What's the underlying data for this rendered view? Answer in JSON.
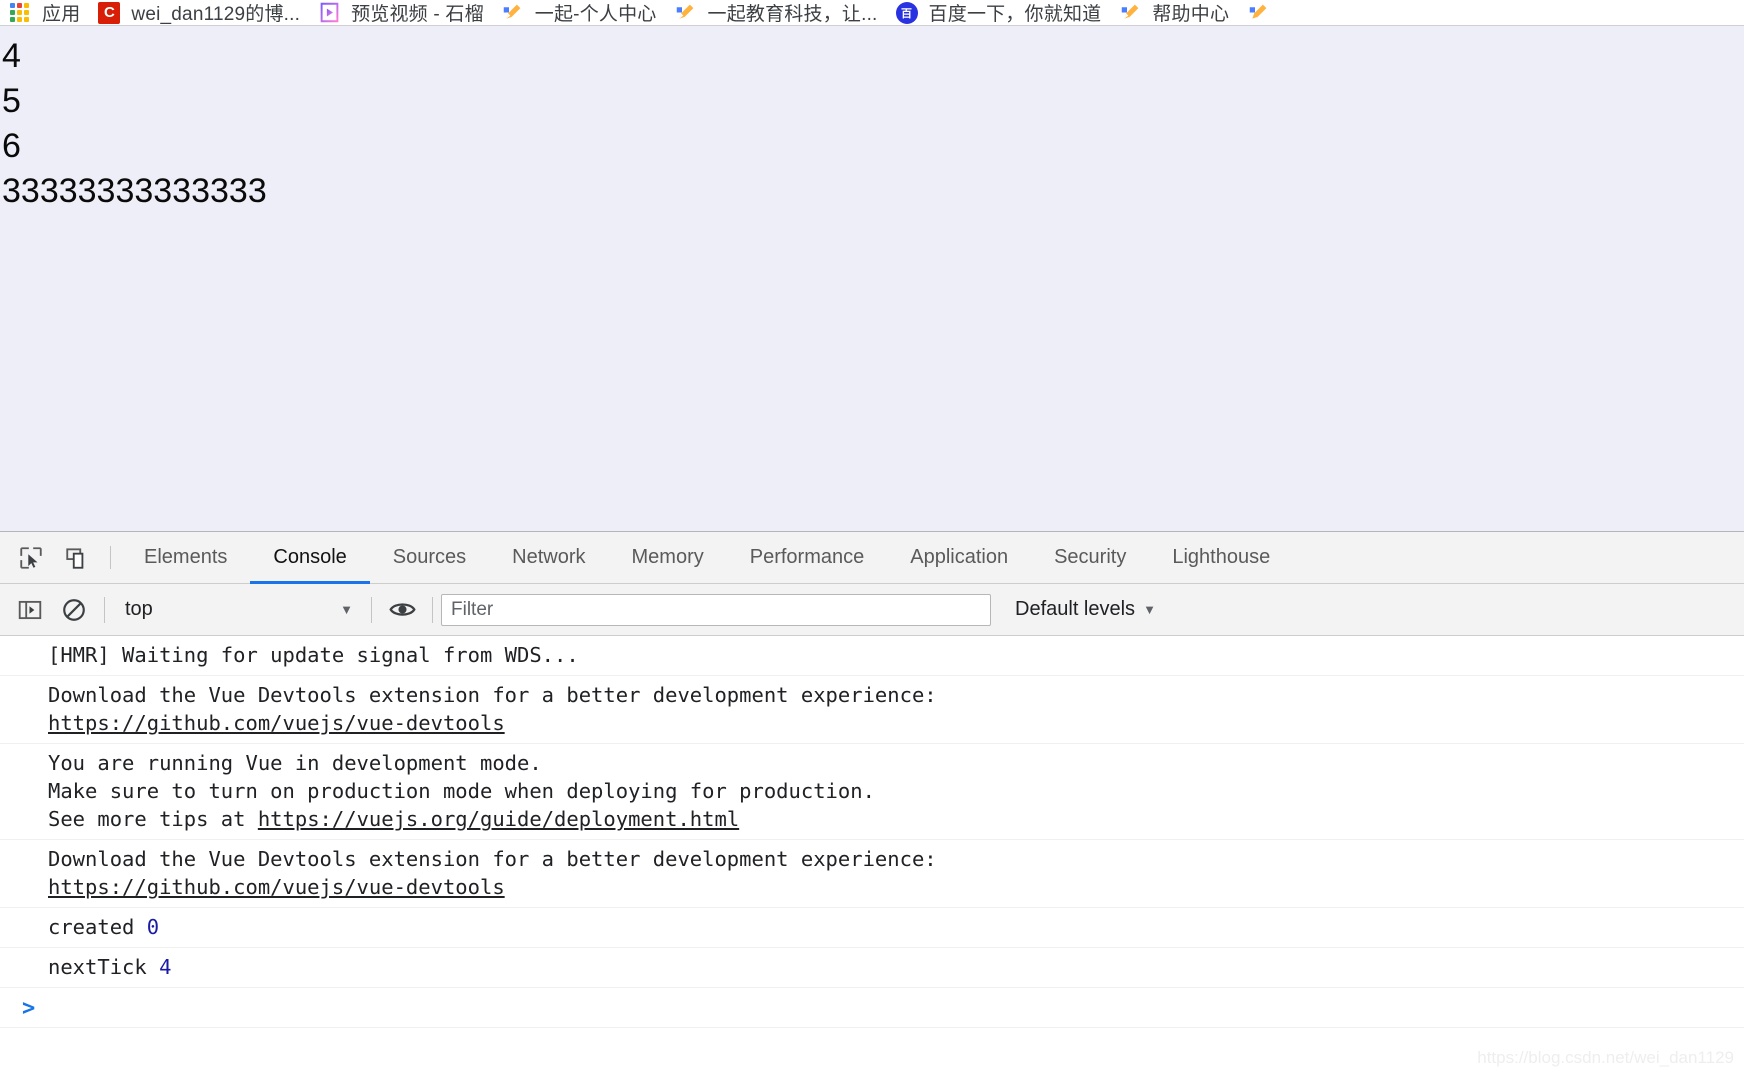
{
  "bookmarks": {
    "items": [
      {
        "label": "应用",
        "icon": "apps-grid-icon"
      },
      {
        "label": "wei_dan1129的博...",
        "icon": "csdn-icon"
      },
      {
        "label": "预览视频 - 石榴",
        "icon": "video-play-icon"
      },
      {
        "label": "一起-个人中心",
        "icon": "pencil-icon"
      },
      {
        "label": "一起教育科技，让...",
        "icon": "pencil-icon"
      },
      {
        "label": "百度一下，你就知道",
        "icon": "baidu-icon"
      },
      {
        "label": "帮助中心",
        "icon": "pencil-icon"
      }
    ],
    "csdn_glyph": "C",
    "baidu_glyph": "百"
  },
  "page": {
    "background_color": "#eeeef8",
    "lines": [
      "4",
      "5",
      "6",
      "33333333333333"
    ]
  },
  "devtools": {
    "toolbar_icons": {
      "inspect": "inspect-element-icon",
      "device": "device-toolbar-icon"
    },
    "tabs": [
      {
        "label": "Elements",
        "active": false
      },
      {
        "label": "Console",
        "active": true
      },
      {
        "label": "Sources",
        "active": false
      },
      {
        "label": "Network",
        "active": false
      },
      {
        "label": "Memory",
        "active": false
      },
      {
        "label": "Performance",
        "active": false
      },
      {
        "label": "Application",
        "active": false
      },
      {
        "label": "Security",
        "active": false
      },
      {
        "label": "Lighthouse",
        "active": false
      }
    ],
    "active_tab_color": "#1a73e8",
    "filterbar": {
      "sidebar_icon": "console-sidebar-icon",
      "clear_icon": "clear-console-icon",
      "context": "top",
      "context_caret": "▼",
      "eye_icon": "live-expression-eye-icon",
      "filter_placeholder": "Filter",
      "filter_value": "",
      "levels": "Default levels",
      "levels_caret": "▼"
    },
    "console": {
      "messages": [
        {
          "id": "hmr",
          "parts": [
            {
              "t": "[HMR] Waiting for update signal from WDS...",
              "k": "text"
            }
          ]
        },
        {
          "id": "vue-devtools-1",
          "parts": [
            {
              "t": "Download the Vue Devtools extension for a better development experience:\n",
              "k": "text"
            },
            {
              "t": "https://github.com/vuejs/vue-devtools",
              "k": "link"
            }
          ]
        },
        {
          "id": "vue-dev-mode",
          "parts": [
            {
              "t": "You are running Vue in development mode.\nMake sure to turn on production mode when deploying for production.\nSee more tips at ",
              "k": "text"
            },
            {
              "t": "https://vuejs.org/guide/deployment.html",
              "k": "link"
            }
          ]
        },
        {
          "id": "vue-devtools-2",
          "parts": [
            {
              "t": "Download the Vue Devtools extension for a better development experience:\n",
              "k": "text"
            },
            {
              "t": "https://github.com/vuejs/vue-devtools",
              "k": "link"
            }
          ]
        },
        {
          "id": "created",
          "parts": [
            {
              "t": "created ",
              "k": "text"
            },
            {
              "t": "0",
              "k": "num"
            }
          ]
        },
        {
          "id": "nexttick",
          "parts": [
            {
              "t": "nextTick ",
              "k": "text"
            },
            {
              "t": "4",
              "k": "num"
            }
          ]
        }
      ],
      "prompt_caret": ">",
      "prompt_value": "",
      "number_color": "#1a1aa6"
    }
  },
  "watermark": "https://blog.csdn.net/wei_dan1129"
}
